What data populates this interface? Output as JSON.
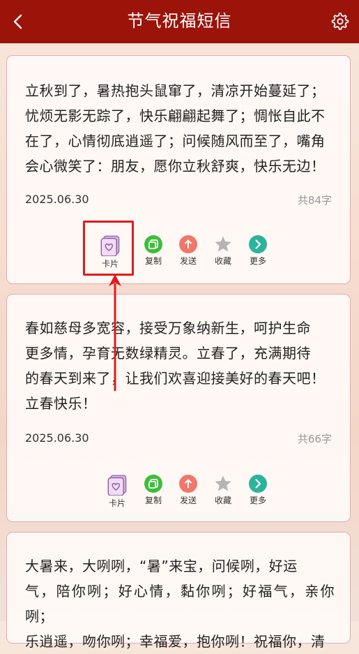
{
  "header": {
    "title": "节气祝福短信",
    "back_icon": "chevron-left-icon",
    "settings_icon": "gear-icon"
  },
  "actions_labels": {
    "card": "卡片",
    "copy": "复制",
    "send": "发送",
    "favorite": "收藏",
    "more": "更多"
  },
  "cards": [
    {
      "lines": [
        "立秋到了，暑热抱头鼠窜了，清凉开始蔓延了；",
        "忧烦无影无踪了，快乐翩翩起舞了；惆怅自此不",
        "在了，心情彻底逍遥了；问候随风而至了，嘴角",
        "会心微笑了：朋友，愿你立秋舒爽，快乐无边！"
      ],
      "date": "2025.06.30",
      "count": "共84字"
    },
    {
      "lines": [
        "春如慈母多宽容，接受万象纳新生，呵护生命",
        "更多情，孕育无数绿精灵。立春了，充满期待",
        "的春天到来了，让我们欢喜迎接美好的春天吧！",
        "立春快乐！"
      ],
      "date": "2025.06.30",
      "count": "共66字"
    },
    {
      "lines": [
        "大暑来，大咧咧，“暑”来宝，问候咧，好运",
        "气，陪你咧；好心情，黏你咧；好福气，亲你咧；",
        "乐逍遥，吻你咧；幸福爱，抱你咧！祝福你，清"
      ]
    }
  ],
  "colors": {
    "header_bg": "#9b1309",
    "card_border": "#e7aab0",
    "copy": "#3cbf3a",
    "send": "#f0776a",
    "favorite": "#b5b5b5",
    "more": "#2db39c",
    "highlight": "#e11b1b"
  }
}
